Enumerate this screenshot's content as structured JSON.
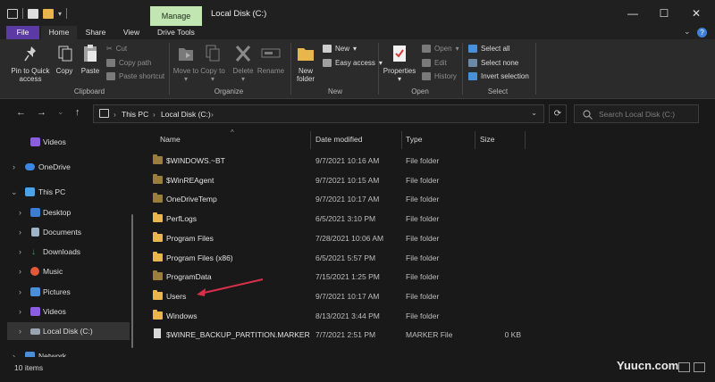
{
  "window": {
    "title": "Local Disk (C:)",
    "manage_tab": "Manage",
    "minimize": "—",
    "maximize": "☐",
    "close": "✕",
    "quick_access_dropdown": "▾"
  },
  "tabs": [
    {
      "label": "File"
    },
    {
      "label": "Home"
    },
    {
      "label": "Share"
    },
    {
      "label": "View"
    },
    {
      "label": "Drive Tools"
    }
  ],
  "tabs_right": {
    "collapse": "⌄",
    "help": "?"
  },
  "ribbon": {
    "clipboard": {
      "pin": "Pin to Quick access",
      "copy": "Copy",
      "paste": "Paste",
      "cut": "Cut",
      "copy_path": "Copy path",
      "paste_shortcut": "Paste shortcut",
      "label": "Clipboard"
    },
    "organize": {
      "move_to": "Move to",
      "copy_to": "Copy to",
      "delete": "Delete",
      "rename": "Rename",
      "label": "Organize"
    },
    "new": {
      "new_folder": "New folder",
      "new_item": "New",
      "easy_access": "Easy access",
      "label": "New"
    },
    "open": {
      "properties": "Properties",
      "open": "Open",
      "edit": "Edit",
      "history": "History",
      "label": "Open"
    },
    "select": {
      "select_all": "Select all",
      "select_none": "Select none",
      "invert_selection": "Invert selection",
      "label": "Select"
    }
  },
  "address": {
    "back": "←",
    "forward": "→",
    "recent": "⌄",
    "up": "↑",
    "crumbs": [
      "This PC",
      "Local Disk (C:)"
    ],
    "separator": "›",
    "dropdown": "⌄",
    "refresh": "⟳",
    "search_placeholder": "Search Local Disk (C:)"
  },
  "nav_pane": [
    {
      "label": "Videos",
      "color": "#8b5ee0"
    },
    {
      "label": "OneDrive",
      "color": "#3a86e0"
    },
    {
      "label": "This PC",
      "color": "#4aa3e8"
    },
    {
      "label": "Desktop",
      "color": "#3a7fd0"
    },
    {
      "label": "Documents",
      "color": "#9fb4c8"
    },
    {
      "label": "Downloads",
      "color": "#3ca55c"
    },
    {
      "label": "Music",
      "color": "#e05a3a"
    },
    {
      "label": "Pictures",
      "color": "#4a90d8"
    },
    {
      "label": "Videos",
      "color": "#8b5ee0"
    },
    {
      "label": "Local Disk (C:)",
      "color": "#9aa4b0"
    },
    {
      "label": "Network",
      "color": "#4a8fd8"
    }
  ],
  "columns": {
    "name": "Name",
    "date": "Date modified",
    "type": "Type",
    "size": "Size",
    "sort_indicator": "^"
  },
  "files": [
    {
      "name": "$WINDOWS.~BT",
      "date": "9/7/2021 10:16 AM",
      "type": "File folder",
      "size": "",
      "color": "#9b7d3c"
    },
    {
      "name": "$WinREAgent",
      "date": "9/7/2021 10:15 AM",
      "type": "File folder",
      "size": "",
      "color": "#9b7d3c"
    },
    {
      "name": "OneDriveTemp",
      "date": "9/7/2021 10:17 AM",
      "type": "File folder",
      "size": "",
      "color": "#9b7d3c"
    },
    {
      "name": "PerfLogs",
      "date": "6/5/2021 3:10 PM",
      "type": "File folder",
      "size": "",
      "color": "#e8b64a"
    },
    {
      "name": "Program Files",
      "date": "7/28/2021 10:06 AM",
      "type": "File folder",
      "size": "",
      "color": "#e8b64a"
    },
    {
      "name": "Program Files (x86)",
      "date": "6/5/2021 5:57 PM",
      "type": "File folder",
      "size": "",
      "color": "#e8b64a"
    },
    {
      "name": "ProgramData",
      "date": "7/15/2021 1:25 PM",
      "type": "File folder",
      "size": "",
      "color": "#9b7d3c"
    },
    {
      "name": "Users",
      "date": "9/7/2021 10:17 AM",
      "type": "File folder",
      "size": "",
      "color": "#e8b64a"
    },
    {
      "name": "Windows",
      "date": "8/13/2021 3:44 PM",
      "type": "File folder",
      "size": "",
      "color": "#e8b64a"
    },
    {
      "name": "$WINRE_BACKUP_PARTITION.MARKER",
      "date": "7/7/2021 2:51 PM",
      "type": "MARKER File",
      "size": "0 KB",
      "color": "#d9d9d9"
    }
  ],
  "status": {
    "items": "10 items"
  },
  "watermark": "Yuucn.com",
  "colors": {
    "accent_file_tab": "#5b3aa4",
    "manage_tab": "#c2e6b2",
    "annotation_arrow": "#d8304a"
  }
}
